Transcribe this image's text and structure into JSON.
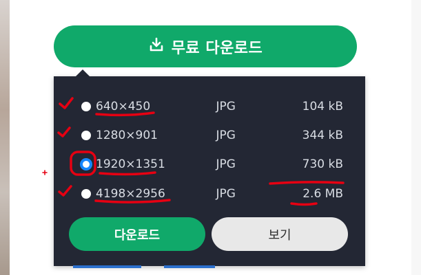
{
  "main_button": {
    "label": "무료 다운로드",
    "icon": "download-icon",
    "color": "#10a96a"
  },
  "download_options": [
    {
      "dimensions": "640×450",
      "format": "JPG",
      "size": "104 kB",
      "selected": false
    },
    {
      "dimensions": "1280×901",
      "format": "JPG",
      "size": "344 kB",
      "selected": false
    },
    {
      "dimensions": "1920×1351",
      "format": "JPG",
      "size": "730 kB",
      "selected": true
    },
    {
      "dimensions": "4198×2956",
      "format": "JPG",
      "size": "2.6 MB",
      "selected": false
    }
  ],
  "actions": {
    "download": "다운로드",
    "view": "보기"
  },
  "colors": {
    "panel": "#232734",
    "selected_radio": "#1787ff",
    "annotation": "#e60012"
  }
}
